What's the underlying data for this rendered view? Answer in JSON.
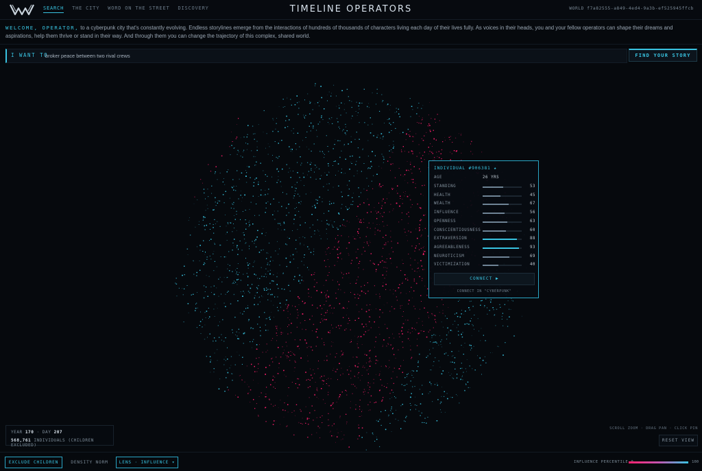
{
  "header": {
    "nav": [
      {
        "label": "SEARCH",
        "active": true
      },
      {
        "label": "THE CITY",
        "active": false
      },
      {
        "label": "WORD ON THE STREET",
        "active": false
      },
      {
        "label": "DISCOVERY",
        "active": false
      }
    ],
    "title": "TIMELINE OPERATORS",
    "world_id": "WORLD f7a82555-a849-4ed4-9a3b-ef525945ffcb"
  },
  "welcome": {
    "highlight": "WELCOME, OPERATOR,",
    "text": " to a cyberpunk city that's constantly evolving. Endless storylines emerge from the interactions of hundreds of thousands of characters living each day of their lives fully. As voices in their heads, you and your fellow operators can shape their dreams and aspirations, help them thrive or stand in their way. And through them you can change the trajectory of this complex, shared world."
  },
  "search": {
    "prefix": "I WANT TO",
    "value": "broker peace between two rival crews",
    "button": "FIND YOUR STORY"
  },
  "card": {
    "title": "INDIVIDUAL #906381 ★",
    "age_label": "AGE",
    "age_value": "26 YRS",
    "stats": [
      {
        "label": "STANDING",
        "value": 53
      },
      {
        "label": "HEALTH",
        "value": 45
      },
      {
        "label": "WEALTH",
        "value": 67
      },
      {
        "label": "INFLUENCE",
        "value": 56
      },
      {
        "label": "OPENNESS",
        "value": 63
      },
      {
        "label": "CONSCIENTIOUSNESS",
        "value": 60
      },
      {
        "label": "EXTRAVERSION",
        "value": 88
      },
      {
        "label": "AGREEABLENESS",
        "value": 93
      },
      {
        "label": "NEUROTICISM",
        "value": 69
      },
      {
        "label": "VICTIMIZATION",
        "value": 40
      }
    ],
    "connect_button": "CONNECT ▶",
    "connect_sub": "CONNECT IN \"CYBERPUNK\""
  },
  "stats": {
    "year_label": "YEAR",
    "year": "170",
    "day_label": "· DAY",
    "day": "207",
    "population": "568,761",
    "population_label": "INDIVIDUALS (CHILDREN EXCLUDED)"
  },
  "view": {
    "hint": "SCROLL ZOOM · DRAG PAN · CLICK PIN",
    "reset": "RESET VIEW"
  },
  "footer": {
    "exclude_children": "EXCLUDE CHILDREN",
    "density_norm": "DENSITY NORM",
    "lens": "LENS · INFLUENCE ▾",
    "legend_label": "INFLUENCE PERCENTILE",
    "legend_min": "0",
    "legend_max": "100"
  },
  "colors": {
    "accent": "#39c4e2",
    "low": "#ff1f6d",
    "high": "#39c4e2",
    "background": "#06090d"
  }
}
